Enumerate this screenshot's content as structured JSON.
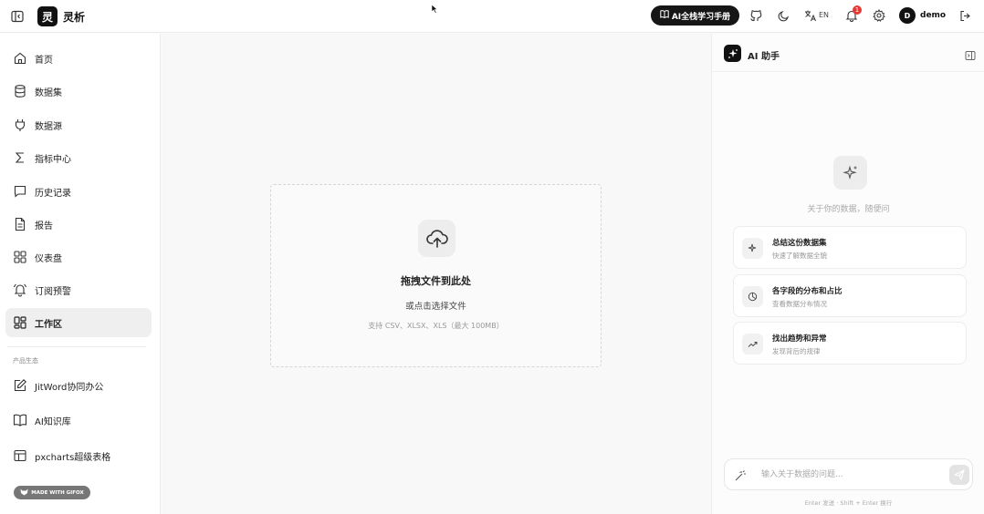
{
  "header": {
    "brand_logo_char": "灵",
    "brand_name": "灵析",
    "guide_button": "AI全栈学习手册",
    "lang_label": "EN",
    "notification_count": "1",
    "user_initial": "D",
    "user_name": "demo",
    "icons": [
      "sidebar-toggle-icon",
      "book-icon",
      "github-icon",
      "moon-icon",
      "translate-icon",
      "bell-icon",
      "gear-icon",
      "logout-icon"
    ]
  },
  "sidebar": {
    "items": [
      {
        "label": "首页",
        "icon": "home-icon"
      },
      {
        "label": "数据集",
        "icon": "database-icon"
      },
      {
        "label": "数据源",
        "icon": "plug-icon"
      },
      {
        "label": "指标中心",
        "icon": "sigma-icon"
      },
      {
        "label": "历史记录",
        "icon": "chat-icon"
      },
      {
        "label": "报告",
        "icon": "document-icon"
      },
      {
        "label": "仪表盘",
        "icon": "dashboard-icon"
      },
      {
        "label": "订阅预警",
        "icon": "bell-alert-icon"
      },
      {
        "label": "工作区",
        "icon": "workspace-icon",
        "active": true
      }
    ],
    "section_label": "产品生态",
    "ecosystem": [
      {
        "label": "JitWord协同办公",
        "icon": "edit-icon"
      },
      {
        "label": "AI知识库",
        "icon": "book-open-icon"
      },
      {
        "label": "pxcharts超级表格",
        "icon": "table-icon"
      }
    ],
    "gifox_badge": "MADE WITH GIFOX"
  },
  "main": {
    "dropzone": {
      "title": "拖拽文件到此处",
      "subtitle": "或点击选择文件",
      "hint": "支持 CSV、XLSX、XLS（最大 100MB）"
    }
  },
  "assistant": {
    "title": "AI 助手",
    "tagline": "关于你的数据，随便问",
    "suggestions": [
      {
        "title": "总结这份数据集",
        "subtitle": "快速了解数据全貌",
        "icon": "sparkle-icon"
      },
      {
        "title": "各字段的分布和占比",
        "subtitle": "查看数据分布情况",
        "icon": "pie-chart-icon"
      },
      {
        "title": "找出趋势和异常",
        "subtitle": "发现背后的规律",
        "icon": "trend-icon"
      }
    ],
    "input_placeholder": "输入关于数据的问题...",
    "input_hint": "Enter 发送 · Shift + Enter 换行"
  },
  "colors": {
    "accent": "#111111",
    "badge": "#e53935",
    "active_nav_bg": "#efefef"
  }
}
